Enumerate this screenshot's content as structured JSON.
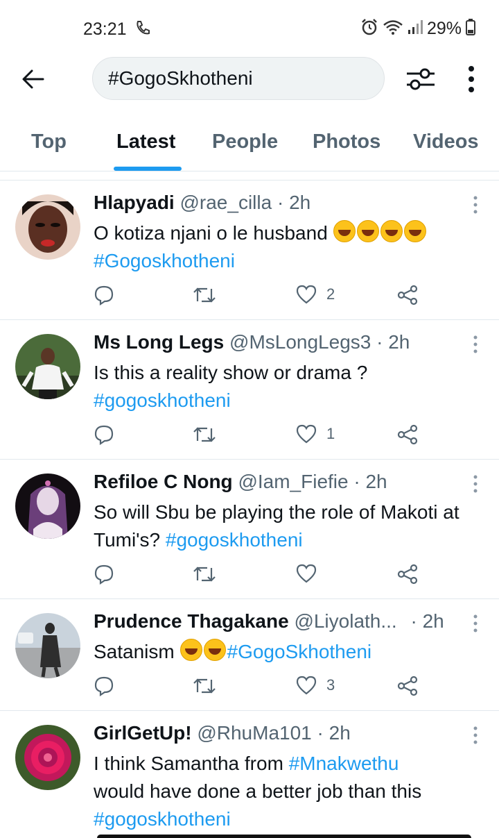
{
  "status": {
    "time": "23:21",
    "battery": "29%"
  },
  "search": {
    "query": "#GogoSkhotheni"
  },
  "tabs": [
    "Top",
    "Latest",
    "People",
    "Photos",
    "Videos"
  ],
  "tweets": [
    {
      "name": "Hlapyadi",
      "handle": "@rae_cilla",
      "dot": "·",
      "time": "2h",
      "text": "O kotiza njani o le husband",
      "tag": "#Gogoskhotheni",
      "likes": "2",
      "avatar_color": "#6b3a2a"
    },
    {
      "name": "Ms Long Legs",
      "handle": "@MsLongLegs3",
      "dot": "·",
      "time": "2h",
      "text": "Is this a reality show or drama ?",
      "tag": "#gogoskhotheni",
      "likes": "1",
      "avatar_color": "#3d5a2a"
    },
    {
      "name": "Refiloe C Nong",
      "handle": "@Iam_Fiefie",
      "dot": "·",
      "time": "2h",
      "text": "So will Sbu be playing the role of Makoti at Tumi's?",
      "tag": "#gogoskhotheni",
      "likes": "",
      "avatar_color": "#2a2030"
    },
    {
      "name": "Prudence Thagakane",
      "handle": "@Liyolath...",
      "dot": "·",
      "time": "2h",
      "text": "Satanism",
      "tag": "#GogoSkhotheni",
      "likes": "3",
      "avatar_color": "#8a8f96"
    },
    {
      "name": "GirlGetUp!",
      "handle": "@RhuMa101",
      "dot": "·",
      "time": "2h",
      "text_a": "I think Samantha from",
      "tag_a": "#Mnakwethu",
      "text_b": "would have done a better job than this",
      "tag": "#gogoskhotheni",
      "avatar_color": "#c2185b"
    }
  ],
  "colors": {
    "accent": "#1d9bf0",
    "text": "#0f1419",
    "muted": "#536471"
  }
}
